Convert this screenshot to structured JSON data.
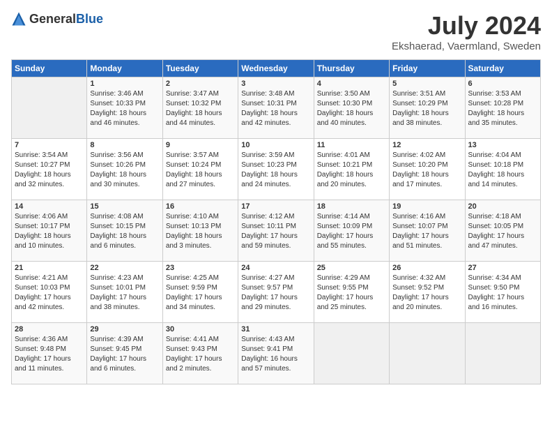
{
  "logo": {
    "text_general": "General",
    "text_blue": "Blue"
  },
  "title": "July 2024",
  "location": "Ekshaerad, Vaermland, Sweden",
  "days_of_week": [
    "Sunday",
    "Monday",
    "Tuesday",
    "Wednesday",
    "Thursday",
    "Friday",
    "Saturday"
  ],
  "weeks": [
    [
      {
        "day": "",
        "empty": true
      },
      {
        "day": "1",
        "sunrise": "Sunrise: 3:46 AM",
        "sunset": "Sunset: 10:33 PM",
        "daylight": "Daylight: 18 hours and 46 minutes."
      },
      {
        "day": "2",
        "sunrise": "Sunrise: 3:47 AM",
        "sunset": "Sunset: 10:32 PM",
        "daylight": "Daylight: 18 hours and 44 minutes."
      },
      {
        "day": "3",
        "sunrise": "Sunrise: 3:48 AM",
        "sunset": "Sunset: 10:31 PM",
        "daylight": "Daylight: 18 hours and 42 minutes."
      },
      {
        "day": "4",
        "sunrise": "Sunrise: 3:50 AM",
        "sunset": "Sunset: 10:30 PM",
        "daylight": "Daylight: 18 hours and 40 minutes."
      },
      {
        "day": "5",
        "sunrise": "Sunrise: 3:51 AM",
        "sunset": "Sunset: 10:29 PM",
        "daylight": "Daylight: 18 hours and 38 minutes."
      },
      {
        "day": "6",
        "sunrise": "Sunrise: 3:53 AM",
        "sunset": "Sunset: 10:28 PM",
        "daylight": "Daylight: 18 hours and 35 minutes."
      }
    ],
    [
      {
        "day": "7",
        "sunrise": "Sunrise: 3:54 AM",
        "sunset": "Sunset: 10:27 PM",
        "daylight": "Daylight: 18 hours and 32 minutes."
      },
      {
        "day": "8",
        "sunrise": "Sunrise: 3:56 AM",
        "sunset": "Sunset: 10:26 PM",
        "daylight": "Daylight: 18 hours and 30 minutes."
      },
      {
        "day": "9",
        "sunrise": "Sunrise: 3:57 AM",
        "sunset": "Sunset: 10:24 PM",
        "daylight": "Daylight: 18 hours and 27 minutes."
      },
      {
        "day": "10",
        "sunrise": "Sunrise: 3:59 AM",
        "sunset": "Sunset: 10:23 PM",
        "daylight": "Daylight: 18 hours and 24 minutes."
      },
      {
        "day": "11",
        "sunrise": "Sunrise: 4:01 AM",
        "sunset": "Sunset: 10:21 PM",
        "daylight": "Daylight: 18 hours and 20 minutes."
      },
      {
        "day": "12",
        "sunrise": "Sunrise: 4:02 AM",
        "sunset": "Sunset: 10:20 PM",
        "daylight": "Daylight: 18 hours and 17 minutes."
      },
      {
        "day": "13",
        "sunrise": "Sunrise: 4:04 AM",
        "sunset": "Sunset: 10:18 PM",
        "daylight": "Daylight: 18 hours and 14 minutes."
      }
    ],
    [
      {
        "day": "14",
        "sunrise": "Sunrise: 4:06 AM",
        "sunset": "Sunset: 10:17 PM",
        "daylight": "Daylight: 18 hours and 10 minutes."
      },
      {
        "day": "15",
        "sunrise": "Sunrise: 4:08 AM",
        "sunset": "Sunset: 10:15 PM",
        "daylight": "Daylight: 18 hours and 6 minutes."
      },
      {
        "day": "16",
        "sunrise": "Sunrise: 4:10 AM",
        "sunset": "Sunset: 10:13 PM",
        "daylight": "Daylight: 18 hours and 3 minutes."
      },
      {
        "day": "17",
        "sunrise": "Sunrise: 4:12 AM",
        "sunset": "Sunset: 10:11 PM",
        "daylight": "Daylight: 17 hours and 59 minutes."
      },
      {
        "day": "18",
        "sunrise": "Sunrise: 4:14 AM",
        "sunset": "Sunset: 10:09 PM",
        "daylight": "Daylight: 17 hours and 55 minutes."
      },
      {
        "day": "19",
        "sunrise": "Sunrise: 4:16 AM",
        "sunset": "Sunset: 10:07 PM",
        "daylight": "Daylight: 17 hours and 51 minutes."
      },
      {
        "day": "20",
        "sunrise": "Sunrise: 4:18 AM",
        "sunset": "Sunset: 10:05 PM",
        "daylight": "Daylight: 17 hours and 47 minutes."
      }
    ],
    [
      {
        "day": "21",
        "sunrise": "Sunrise: 4:21 AM",
        "sunset": "Sunset: 10:03 PM",
        "daylight": "Daylight: 17 hours and 42 minutes."
      },
      {
        "day": "22",
        "sunrise": "Sunrise: 4:23 AM",
        "sunset": "Sunset: 10:01 PM",
        "daylight": "Daylight: 17 hours and 38 minutes."
      },
      {
        "day": "23",
        "sunrise": "Sunrise: 4:25 AM",
        "sunset": "Sunset: 9:59 PM",
        "daylight": "Daylight: 17 hours and 34 minutes."
      },
      {
        "day": "24",
        "sunrise": "Sunrise: 4:27 AM",
        "sunset": "Sunset: 9:57 PM",
        "daylight": "Daylight: 17 hours and 29 minutes."
      },
      {
        "day": "25",
        "sunrise": "Sunrise: 4:29 AM",
        "sunset": "Sunset: 9:55 PM",
        "daylight": "Daylight: 17 hours and 25 minutes."
      },
      {
        "day": "26",
        "sunrise": "Sunrise: 4:32 AM",
        "sunset": "Sunset: 9:52 PM",
        "daylight": "Daylight: 17 hours and 20 minutes."
      },
      {
        "day": "27",
        "sunrise": "Sunrise: 4:34 AM",
        "sunset": "Sunset: 9:50 PM",
        "daylight": "Daylight: 17 hours and 16 minutes."
      }
    ],
    [
      {
        "day": "28",
        "sunrise": "Sunrise: 4:36 AM",
        "sunset": "Sunset: 9:48 PM",
        "daylight": "Daylight: 17 hours and 11 minutes."
      },
      {
        "day": "29",
        "sunrise": "Sunrise: 4:39 AM",
        "sunset": "Sunset: 9:45 PM",
        "daylight": "Daylight: 17 hours and 6 minutes."
      },
      {
        "day": "30",
        "sunrise": "Sunrise: 4:41 AM",
        "sunset": "Sunset: 9:43 PM",
        "daylight": "Daylight: 17 hours and 2 minutes."
      },
      {
        "day": "31",
        "sunrise": "Sunrise: 4:43 AM",
        "sunset": "Sunset: 9:41 PM",
        "daylight": "Daylight: 16 hours and 57 minutes."
      },
      {
        "day": "",
        "empty": true
      },
      {
        "day": "",
        "empty": true
      },
      {
        "day": "",
        "empty": true
      }
    ]
  ]
}
